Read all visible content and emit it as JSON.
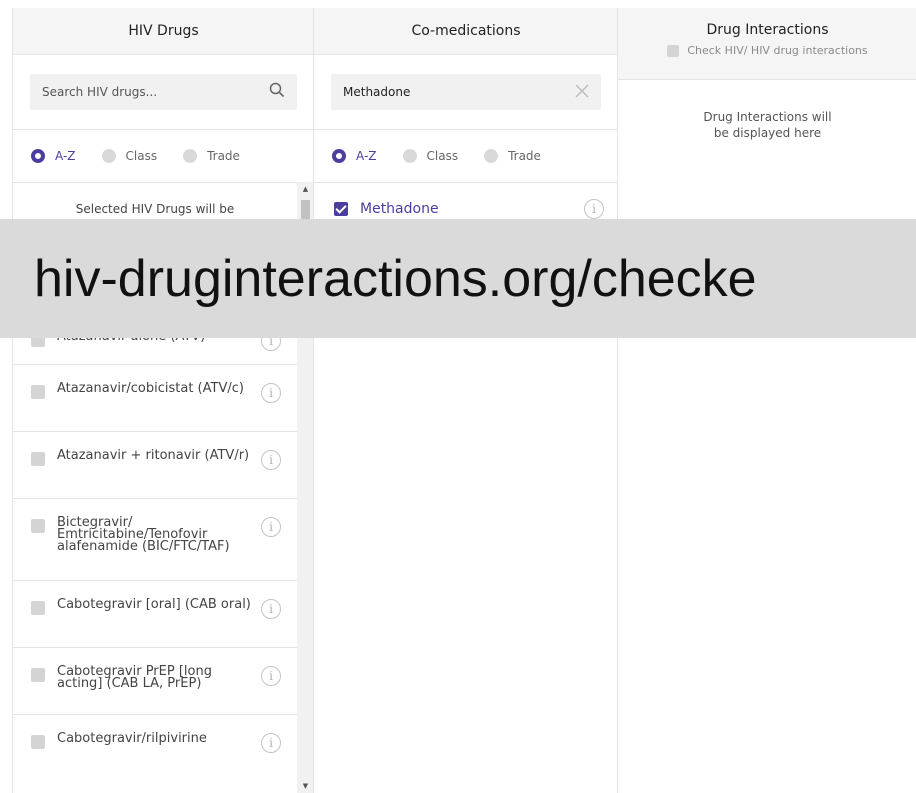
{
  "columns": {
    "hiv": {
      "title": "HIV Drugs",
      "search_placeholder": "Search HIV drugs...",
      "sort_options": [
        "A-Z",
        "Class",
        "Trade"
      ],
      "sort_selected": "A-Z",
      "selected_note": "Selected HIV Drugs will be",
      "drugs": [
        "Atazanavir alone (ATV)",
        "Atazanavir/cobicistat (ATV/c)",
        "Atazanavir + ritonavir (ATV/r)",
        "Bictegravir/ Emtricitabine/Tenofovir alafenamide (BIC/FTC/TAF)",
        "Cabotegravir [oral] (CAB oral)",
        "Cabotegravir PrEP [long acting] (CAB LA, PrEP)",
        "Cabotegravir/rilpivirine"
      ]
    },
    "comed": {
      "title": "Co-medications",
      "search_value": "Methadone",
      "sort_options": [
        "A-Z",
        "Class",
        "Trade"
      ],
      "sort_selected": "A-Z",
      "items": [
        {
          "label": "Methadone",
          "checked": true
        }
      ]
    },
    "interactions": {
      "title": "Drug Interactions",
      "check_label": "Check HIV/ HIV drug interactions",
      "placeholder_line1": "Drug Interactions will",
      "placeholder_line2": "be displayed here"
    }
  },
  "banner": {
    "url_text": "hiv-druginteractions.org/checke"
  },
  "colors": {
    "accent": "#4a3f9f",
    "header_bg": "#f5f5f5",
    "banner_bg": "#dadada"
  }
}
